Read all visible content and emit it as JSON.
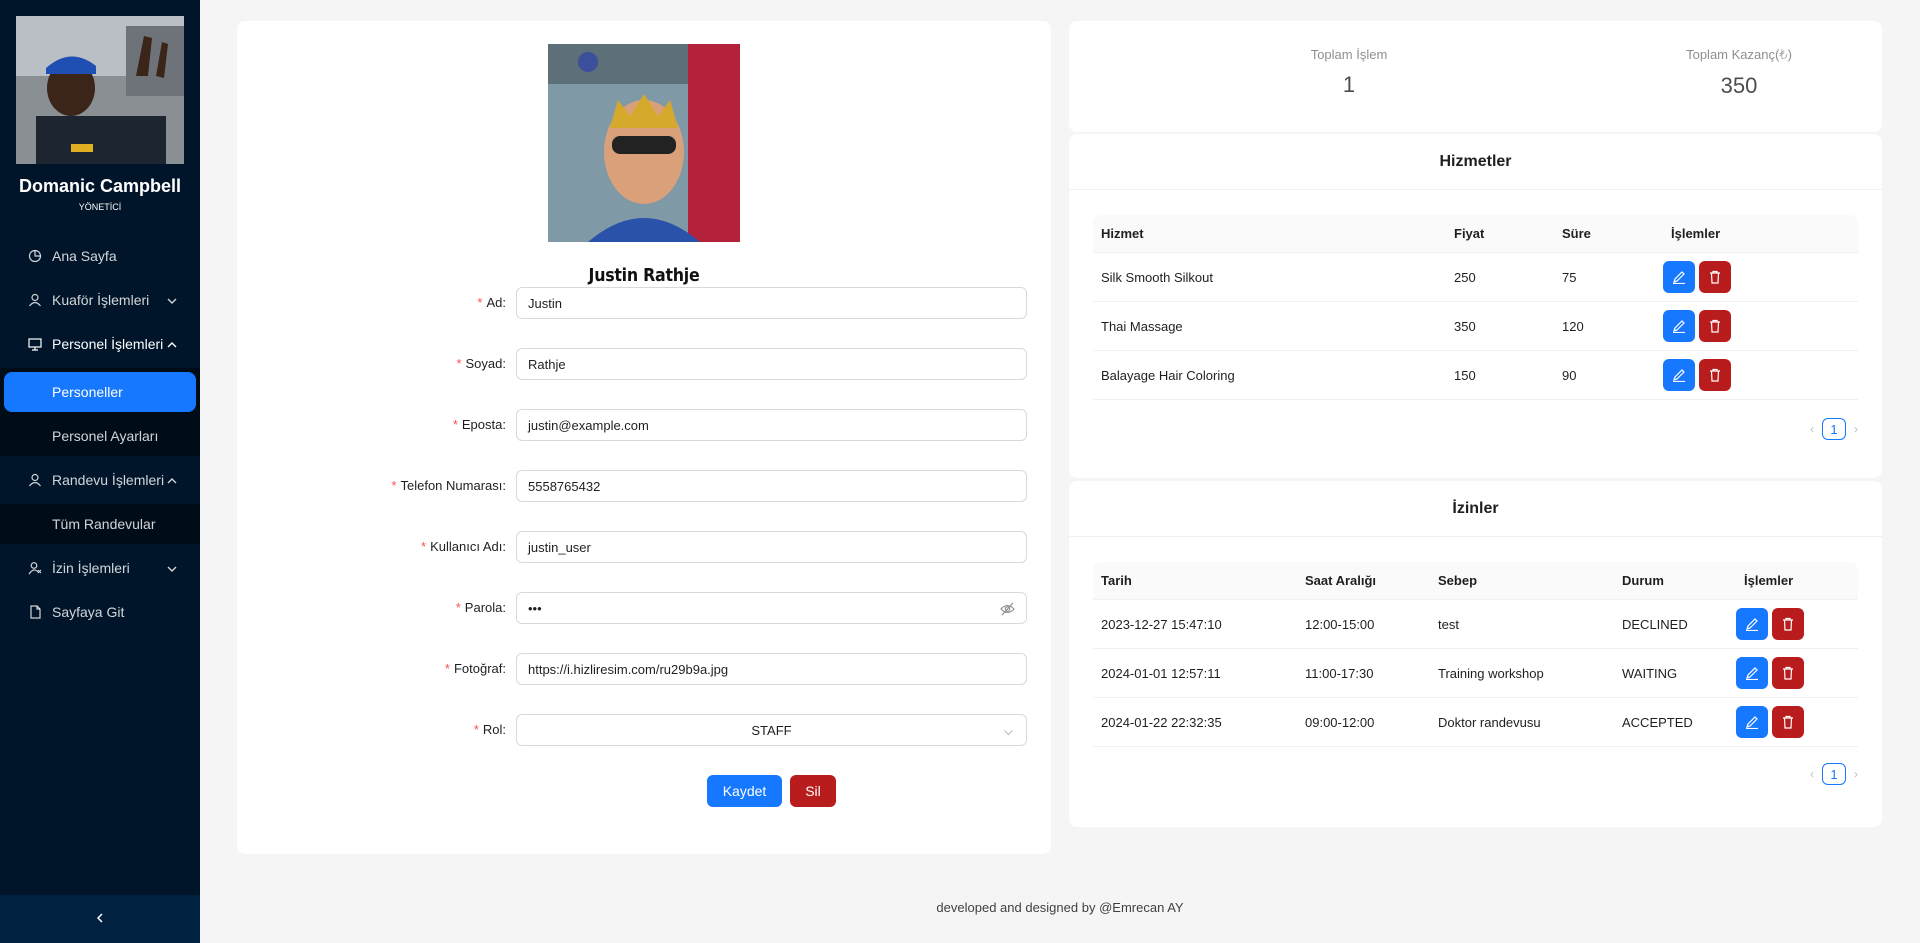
{
  "sidebar": {
    "user_name": "Domanic Campbell",
    "user_role": "YÖNETİCİ",
    "menu": {
      "home": "Ana Sayfa",
      "hairdresser": "Kuaför İşlemleri",
      "staff": "Personel İşlemleri",
      "staff_list": "Personeller",
      "staff_settings": "Personel Ayarları",
      "appointments": "Randevu İşlemleri",
      "all_appointments": "Tüm Randevular",
      "leave": "İzin İşlemleri",
      "goto_page": "Sayfaya Git"
    }
  },
  "profile": {
    "name": "Justin Rathje"
  },
  "form": {
    "first_name": {
      "label": "Ad",
      "value": "Justin"
    },
    "last_name": {
      "label": "Soyad",
      "value": "Rathje"
    },
    "email": {
      "label": "Eposta",
      "value": "justin@example.com"
    },
    "phone": {
      "label": "Telefon Numarası",
      "value": "5558765432"
    },
    "username": {
      "label": "Kullanıcı Adı",
      "value": "justin_user"
    },
    "password": {
      "label": "Parola",
      "value": "•••"
    },
    "photo": {
      "label": "Fotoğraf",
      "value": "https://i.hizliresim.com/ru29b9a.jpg"
    },
    "role": {
      "label": "Rol",
      "value": "STAFF"
    },
    "save_label": "Kaydet",
    "delete_label": "Sil"
  },
  "stats": {
    "total_ops_label": "Toplam İşlem",
    "total_ops_value": "1",
    "total_earnings_label": "Toplam Kazanç(₺)",
    "total_earnings_value": "350"
  },
  "services": {
    "title": "Hizmetler",
    "columns": [
      "Hizmet",
      "Fiyat",
      "Süre",
      "İşlemler"
    ],
    "rows": [
      {
        "name": "Silk Smooth Silkout",
        "price": "250",
        "duration": "75"
      },
      {
        "name": "Thai Massage",
        "price": "350",
        "duration": "120"
      },
      {
        "name": "Balayage Hair Coloring",
        "price": "150",
        "duration": "90"
      }
    ],
    "page": "1"
  },
  "leaves": {
    "title": "İzinler",
    "columns": [
      "Tarih",
      "Saat Aralığı",
      "Sebep",
      "Durum",
      "İşlemler"
    ],
    "rows": [
      {
        "date": "2023-12-27 15:47:10",
        "range": "12:00-15:00",
        "reason": "test",
        "status": "DECLINED"
      },
      {
        "date": "2024-01-01 12:57:11",
        "range": "11:00-17:30",
        "reason": "Training workshop",
        "status": "WAITING"
      },
      {
        "date": "2024-01-22 22:32:35",
        "range": "09:00-12:00",
        "reason": "Doktor randevusu",
        "status": "ACCEPTED"
      }
    ],
    "page": "1"
  },
  "footer": {
    "text": "developed and designed by",
    "author": "@Emrecan AY"
  }
}
